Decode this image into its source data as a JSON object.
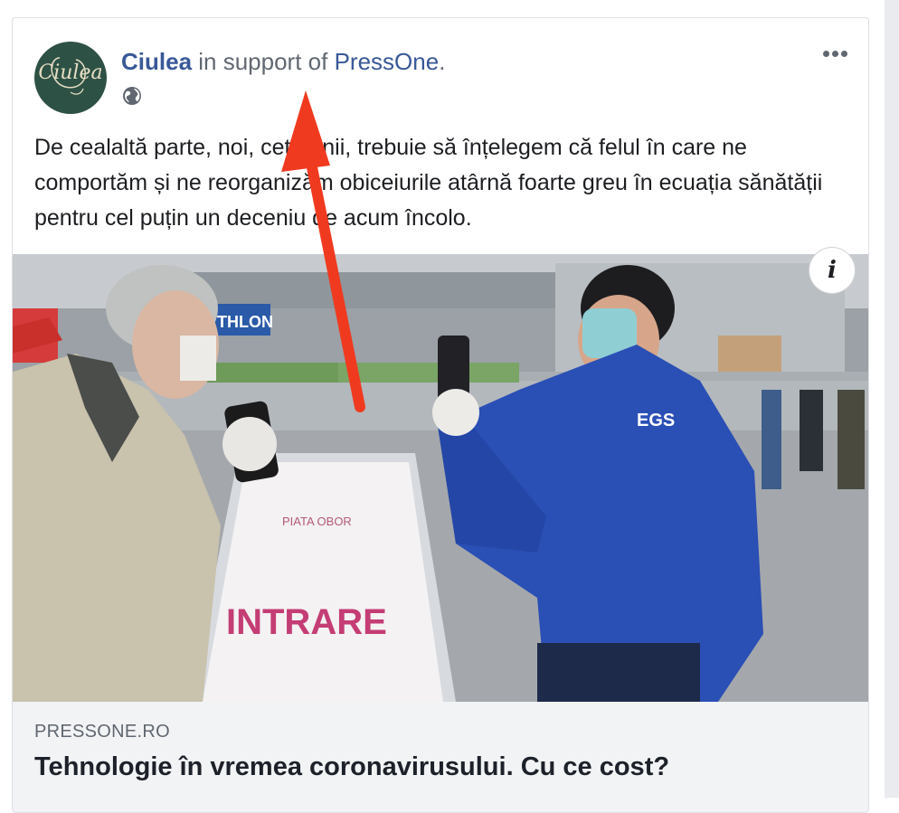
{
  "post": {
    "author": "Ciulea",
    "connector": " in support of ",
    "page": "PressOne",
    "period": ".",
    "avatar_text": "Ciulea",
    "privacy_icon": "globe-icon",
    "more_icon": "more-options-icon",
    "text": "De cealaltă parte, noi, cetățenii, trebuie să înțelegem că felul în care ne comportăm și ne reorganizăm obiceiurile atârnă foarte greu în ecuația sănătății pentru cel puțin un deceniu de acum încolo."
  },
  "media": {
    "info_label": "i",
    "sign_brand": "PIATA OBOR",
    "sign_text": "INTRARE",
    "store_sign": "THLON",
    "jacket_logo": "EGS"
  },
  "link_preview": {
    "domain": "PRESSONE.RO",
    "title": "Tehnologie în vremea coronavirusului. Cu ce cost?"
  },
  "colors": {
    "link": "#385898",
    "annotation_arrow": "#f03a1f",
    "avatar_bg": "#2e5145"
  }
}
